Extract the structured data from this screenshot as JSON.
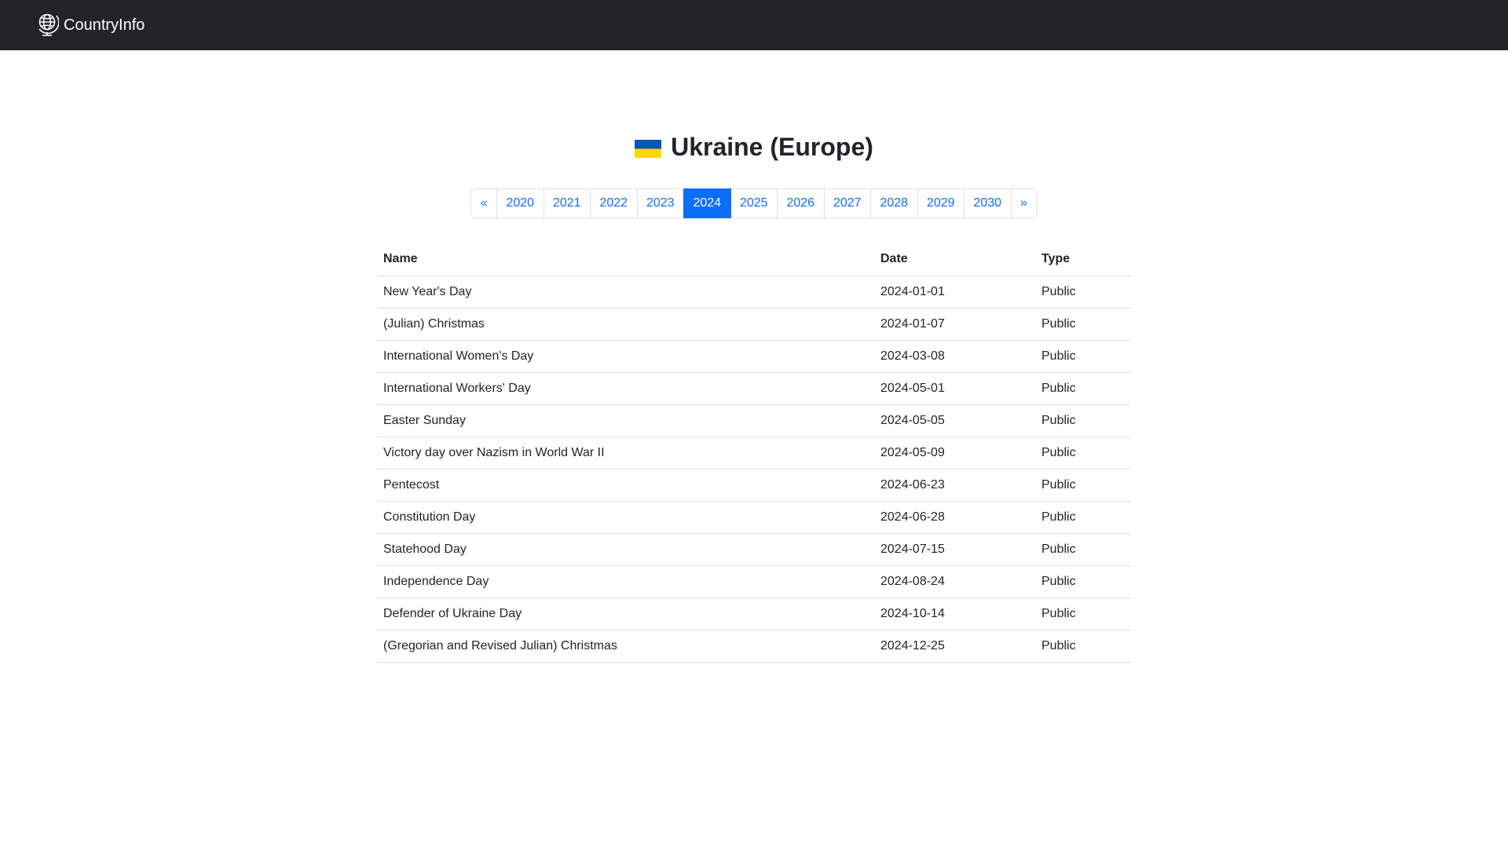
{
  "navbar": {
    "brand_label": "CountryInfo",
    "brand_icon": "globe-icon"
  },
  "page": {
    "flag": "ukraine-flag",
    "flag_colors": {
      "top": "#0057B7",
      "bottom": "#FFD700"
    },
    "title": "Ukraine (Europe)"
  },
  "pagination": {
    "prev_label": "«",
    "next_label": "»",
    "years": [
      "2020",
      "2021",
      "2022",
      "2023",
      "2024",
      "2025",
      "2026",
      "2027",
      "2028",
      "2029",
      "2030"
    ],
    "active_year": "2024"
  },
  "table": {
    "headers": {
      "name": "Name",
      "date": "Date",
      "type": "Type"
    },
    "rows": [
      {
        "name": "New Year's Day",
        "date": "2024-01-01",
        "type": "Public"
      },
      {
        "name": "(Julian) Christmas",
        "date": "2024-01-07",
        "type": "Public"
      },
      {
        "name": "International Women's Day",
        "date": "2024-03-08",
        "type": "Public"
      },
      {
        "name": "International Workers' Day",
        "date": "2024-05-01",
        "type": "Public"
      },
      {
        "name": "Easter Sunday",
        "date": "2024-05-05",
        "type": "Public"
      },
      {
        "name": "Victory day over Nazism in World War II",
        "date": "2024-05-09",
        "type": "Public"
      },
      {
        "name": "Pentecost",
        "date": "2024-06-23",
        "type": "Public"
      },
      {
        "name": "Constitution Day",
        "date": "2024-06-28",
        "type": "Public"
      },
      {
        "name": "Statehood Day",
        "date": "2024-07-15",
        "type": "Public"
      },
      {
        "name": "Independence Day",
        "date": "2024-08-24",
        "type": "Public"
      },
      {
        "name": "Defender of Ukraine Day",
        "date": "2024-10-14",
        "type": "Public"
      },
      {
        "name": "(Gregorian and Revised Julian) Christmas",
        "date": "2024-12-25",
        "type": "Public"
      }
    ]
  },
  "colors": {
    "navbar_bg": "#212529",
    "accent": "#0d6efd",
    "border": "#dee2e6"
  }
}
